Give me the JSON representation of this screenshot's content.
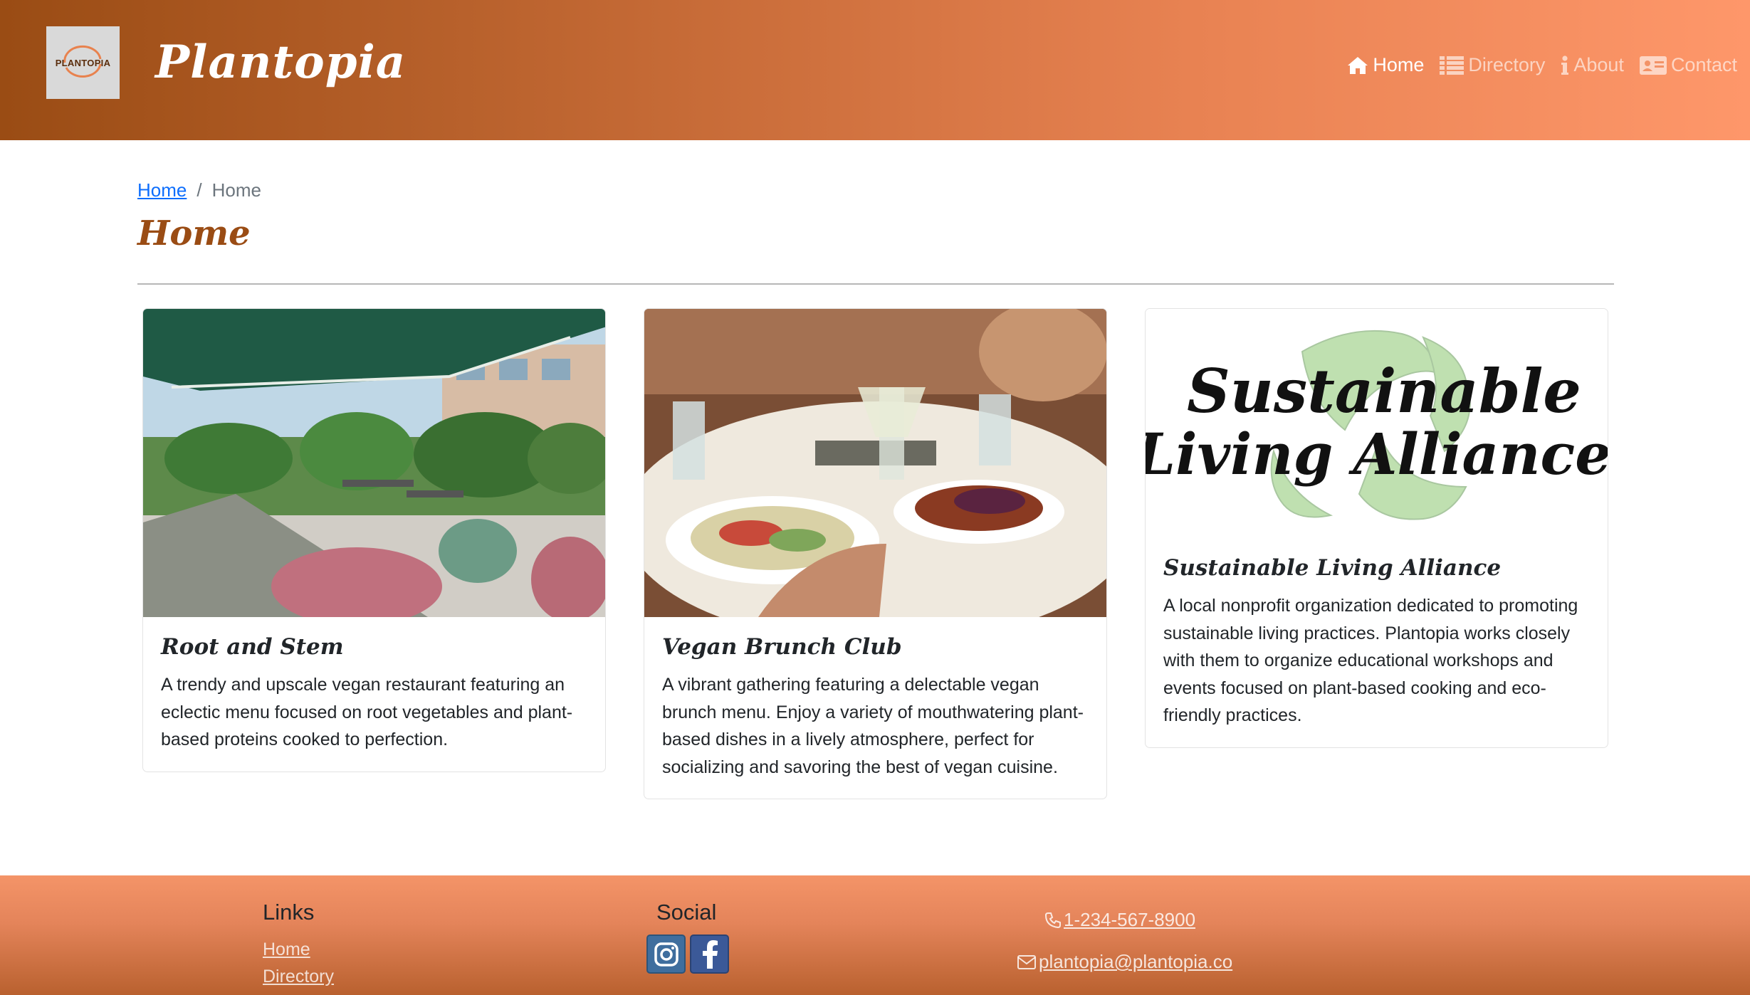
{
  "header": {
    "logo_text": "PLANTOPIA",
    "brand_name": "Plantopia",
    "nav": [
      {
        "label": "Home",
        "icon": "home-icon",
        "active": true
      },
      {
        "label": "Directory",
        "icon": "list-icon",
        "active": false
      },
      {
        "label": "About",
        "icon": "info-icon",
        "active": false
      },
      {
        "label": "Contact",
        "icon": "address-card-icon",
        "active": false
      }
    ]
  },
  "breadcrumb": {
    "link": "Home",
    "separator": "/",
    "current": "Home"
  },
  "page_title": "Home",
  "cards": [
    {
      "title": "Root and Stem",
      "text": "A trendy and upscale vegan restaurant featuring an eclectic menu focused on root vegetables and plant-based proteins cooked to perfection.",
      "image": "restaurant-terrace-photo"
    },
    {
      "title": "Vegan Brunch Club",
      "text": "A vibrant gathering featuring a delectable vegan brunch menu. Enjoy a variety of mouthwatering plant-based dishes in a lively atmosphere, perfect for socializing and savoring the best of vegan cuisine.",
      "image": "brunch-table-photo"
    },
    {
      "title": "Sustainable Living Alliance",
      "text": "A local nonprofit organization dedicated to promoting sustainable living practices. Plantopia works closely with them to organize educational workshops and events focused on plant-based cooking and eco-friendly practices.",
      "image": "sustainable-living-alliance-logo",
      "logo_line1": "Sustainable",
      "logo_line2": "Living Alliance"
    }
  ],
  "footer": {
    "links_heading": "Links",
    "links": [
      "Home",
      "Directory"
    ],
    "social_heading": "Social",
    "social": [
      "instagram-icon",
      "facebook-icon"
    ],
    "phone": " 1-234-567-8900",
    "email": " plantopia@plantopia.co"
  },
  "colors": {
    "header_start": "#9a4c14",
    "header_end": "#fe976a",
    "title": "#9a4c14",
    "link": "#0d6efd",
    "footer_top": "#f49468",
    "footer_bottom": "#b9612f"
  }
}
